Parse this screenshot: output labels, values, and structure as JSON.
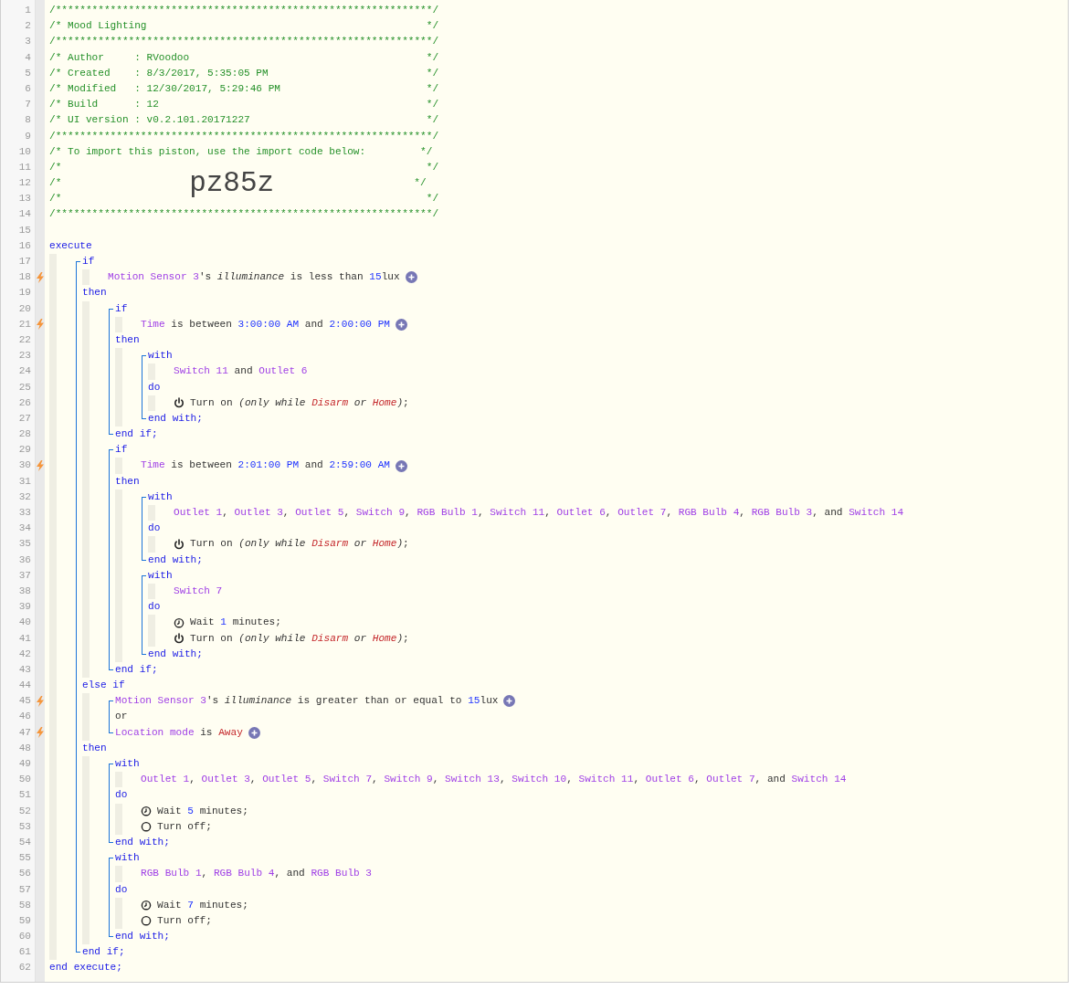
{
  "listing": [
    {
      "num": "1",
      "trigger": false,
      "segments": [
        {
          "kind": "comment",
          "text": "/**************************************************************/"
        }
      ]
    },
    {
      "num": "2",
      "trigger": false,
      "segments": [
        {
          "kind": "comment",
          "text": "/* Mood Lighting                                              */"
        }
      ]
    },
    {
      "num": "3",
      "trigger": false,
      "segments": [
        {
          "kind": "comment",
          "text": "/**************************************************************/"
        }
      ]
    },
    {
      "num": "4",
      "trigger": false,
      "segments": [
        {
          "kind": "comment",
          "text": "/* Author     : RVoodoo                                       */"
        }
      ]
    },
    {
      "num": "5",
      "trigger": false,
      "segments": [
        {
          "kind": "comment",
          "text": "/* Created    : 8/3/2017, 5:35:05 PM                          */"
        }
      ]
    },
    {
      "num": "6",
      "trigger": false,
      "segments": [
        {
          "kind": "comment",
          "text": "/* Modified   : 12/30/2017, 5:29:46 PM                        */"
        }
      ]
    },
    {
      "num": "7",
      "trigger": false,
      "segments": [
        {
          "kind": "comment",
          "text": "/* Build      : 12                                            */"
        }
      ]
    },
    {
      "num": "8",
      "trigger": false,
      "segments": [
        {
          "kind": "comment",
          "text": "/* UI version : v0.2.101.20171227                             */"
        }
      ]
    },
    {
      "num": "9",
      "trigger": false,
      "segments": [
        {
          "kind": "comment",
          "text": "/**************************************************************/"
        }
      ]
    },
    {
      "num": "10",
      "trigger": false,
      "segments": [
        {
          "kind": "comment",
          "text": "/* To import this piston, use the import code below:         */"
        }
      ]
    },
    {
      "num": "11",
      "trigger": false,
      "segments": [
        {
          "kind": "comment",
          "text": "/*                                                            */"
        }
      ]
    },
    {
      "num": "12",
      "trigger": false,
      "segments": [
        {
          "kind": "comment",
          "text": "/*                     "
        },
        {
          "kind": "code",
          "text": "pz85z"
        },
        {
          "kind": "comment",
          "text": "                       */"
        }
      ]
    },
    {
      "num": "13",
      "trigger": false,
      "segments": [
        {
          "kind": "comment",
          "text": "/*                                                            */"
        }
      ]
    },
    {
      "num": "14",
      "trigger": false,
      "segments": [
        {
          "kind": "comment",
          "text": "/**************************************************************/"
        }
      ]
    },
    {
      "num": "15",
      "trigger": false
    },
    {
      "header": {
        "num": "16",
        "trigger": false,
        "segments": [
          {
            "kind": "kw",
            "text": "execute"
          }
        ]
      },
      "body": [
        {
          "items": [
            {
              "header": {
                "num": "17",
                "trigger": false,
                "segments": [
                  {
                    "kind": "kw",
                    "text": "if"
                  }
                ]
              },
              "body": [
                {
                  "num": "18",
                  "trigger": true,
                  "segments": [
                    {
                      "kind": "dev",
                      "text": "Motion Sensor 3"
                    },
                    {
                      "kind": "txt",
                      "text": "'s "
                    },
                    {
                      "kind": "em",
                      "text": "illuminance"
                    },
                    {
                      "kind": "txt",
                      "text": " is less than "
                    },
                    {
                      "kind": "num",
                      "text": "15"
                    },
                    {
                      "kind": "txt",
                      "text": "lux"
                    },
                    {
                      "kind": "add"
                    }
                  ]
                }
              ]
            },
            {
              "header": {
                "num": "19",
                "trigger": false,
                "segments": [
                  {
                    "kind": "kw",
                    "text": "then"
                  }
                ]
              },
              "body": [
                {
                  "items": [
                    {
                      "header": {
                        "num": "20",
                        "trigger": false,
                        "segments": [
                          {
                            "kind": "kw",
                            "text": "if"
                          }
                        ]
                      },
                      "body": [
                        {
                          "num": "21",
                          "trigger": true,
                          "segments": [
                            {
                              "kind": "dev",
                              "text": "Time"
                            },
                            {
                              "kind": "txt",
                              "text": " is between "
                            },
                            {
                              "kind": "num",
                              "text": "3:00:00 AM"
                            },
                            {
                              "kind": "txt",
                              "text": " and "
                            },
                            {
                              "kind": "num",
                              "text": "2:00:00 PM"
                            },
                            {
                              "kind": "add"
                            }
                          ]
                        }
                      ]
                    },
                    {
                      "header": {
                        "num": "22",
                        "trigger": false,
                        "segments": [
                          {
                            "kind": "kw",
                            "text": "then"
                          }
                        ]
                      },
                      "body": [
                        {
                          "items": [
                            {
                              "header": {
                                "num": "23",
                                "trigger": false,
                                "segments": [
                                  {
                                    "kind": "kw",
                                    "text": "with"
                                  }
                                ]
                              },
                              "body": [
                                {
                                  "num": "24",
                                  "trigger": false,
                                  "segments": [
                                    {
                                      "kind": "dev",
                                      "text": "Switch 11"
                                    },
                                    {
                                      "kind": "txt",
                                      "text": " and "
                                    },
                                    {
                                      "kind": "dev",
                                      "text": "Outlet 6"
                                    }
                                  ]
                                }
                              ]
                            },
                            {
                              "header": {
                                "num": "25",
                                "trigger": false,
                                "segments": [
                                  {
                                    "kind": "kw",
                                    "text": "do"
                                  }
                                ]
                              },
                              "body": [
                                {
                                  "num": "26",
                                  "trigger": false,
                                  "kind": "on",
                                  "segments": [
                                    {
                                      "kind": "txt",
                                      "text": "Turn on "
                                    },
                                    {
                                      "kind": "em",
                                      "text": "(only while "
                                    },
                                    {
                                      "kind": "red-em",
                                      "text": "Disarm"
                                    },
                                    {
                                      "kind": "em",
                                      "text": " or "
                                    },
                                    {
                                      "kind": "red-em",
                                      "text": "Home"
                                    },
                                    {
                                      "kind": "em",
                                      "text": ")"
                                    },
                                    {
                                      "kind": "txt",
                                      "text": ";"
                                    }
                                  ]
                                }
                              ]
                            },
                            {
                              "num": "27",
                              "trigger": false,
                              "segments": [
                                {
                                  "kind": "kw",
                                  "text": "end with;"
                                }
                              ]
                            }
                          ]
                        }
                      ]
                    },
                    {
                      "num": "28",
                      "trigger": false,
                      "segments": [
                        {
                          "kind": "kw",
                          "text": "end if;"
                        }
                      ]
                    }
                  ]
                },
                {
                  "items": [
                    {
                      "header": {
                        "num": "29",
                        "trigger": false,
                        "segments": [
                          {
                            "kind": "kw",
                            "text": "if"
                          }
                        ]
                      },
                      "body": [
                        {
                          "num": "30",
                          "trigger": true,
                          "segments": [
                            {
                              "kind": "dev",
                              "text": "Time"
                            },
                            {
                              "kind": "txt",
                              "text": " is between "
                            },
                            {
                              "kind": "num",
                              "text": "2:01:00 PM"
                            },
                            {
                              "kind": "txt",
                              "text": " and "
                            },
                            {
                              "kind": "num",
                              "text": "2:59:00 AM"
                            },
                            {
                              "kind": "add"
                            }
                          ]
                        }
                      ]
                    },
                    {
                      "header": {
                        "num": "31",
                        "trigger": false,
                        "segments": [
                          {
                            "kind": "kw",
                            "text": "then"
                          }
                        ]
                      },
                      "body": [
                        {
                          "items": [
                            {
                              "header": {
                                "num": "32",
                                "trigger": false,
                                "segments": [
                                  {
                                    "kind": "kw",
                                    "text": "with"
                                  }
                                ]
                              },
                              "body": [
                                {
                                  "num": "33",
                                  "trigger": false,
                                  "segments": [
                                    {
                                      "kind": "dev",
                                      "text": "Outlet 1"
                                    },
                                    {
                                      "kind": "txt",
                                      "text": ", "
                                    },
                                    {
                                      "kind": "dev",
                                      "text": "Outlet 3"
                                    },
                                    {
                                      "kind": "txt",
                                      "text": ", "
                                    },
                                    {
                                      "kind": "dev",
                                      "text": "Outlet 5"
                                    },
                                    {
                                      "kind": "txt",
                                      "text": ", "
                                    },
                                    {
                                      "kind": "dev",
                                      "text": "Switch 9"
                                    },
                                    {
                                      "kind": "txt",
                                      "text": ", "
                                    },
                                    {
                                      "kind": "dev",
                                      "text": "RGB Bulb 1"
                                    },
                                    {
                                      "kind": "txt",
                                      "text": ", "
                                    },
                                    {
                                      "kind": "dev",
                                      "text": "Switch 11"
                                    },
                                    {
                                      "kind": "txt",
                                      "text": ", "
                                    },
                                    {
                                      "kind": "dev",
                                      "text": "Outlet 6"
                                    },
                                    {
                                      "kind": "txt",
                                      "text": ", "
                                    },
                                    {
                                      "kind": "dev",
                                      "text": "Outlet 7"
                                    },
                                    {
                                      "kind": "txt",
                                      "text": ", "
                                    },
                                    {
                                      "kind": "dev",
                                      "text": "RGB Bulb 4"
                                    },
                                    {
                                      "kind": "txt",
                                      "text": ", "
                                    },
                                    {
                                      "kind": "dev",
                                      "text": "RGB Bulb 3"
                                    },
                                    {
                                      "kind": "txt",
                                      "text": ", and "
                                    },
                                    {
                                      "kind": "dev",
                                      "text": "Switch 14"
                                    }
                                  ]
                                }
                              ]
                            },
                            {
                              "header": {
                                "num": "34",
                                "trigger": false,
                                "segments": [
                                  {
                                    "kind": "kw",
                                    "text": "do"
                                  }
                                ]
                              },
                              "body": [
                                {
                                  "num": "35",
                                  "trigger": false,
                                  "kind": "on",
                                  "segments": [
                                    {
                                      "kind": "txt",
                                      "text": "Turn on "
                                    },
                                    {
                                      "kind": "em",
                                      "text": "(only while "
                                    },
                                    {
                                      "kind": "red-em",
                                      "text": "Disarm"
                                    },
                                    {
                                      "kind": "em",
                                      "text": " or "
                                    },
                                    {
                                      "kind": "red-em",
                                      "text": "Home"
                                    },
                                    {
                                      "kind": "em",
                                      "text": ")"
                                    },
                                    {
                                      "kind": "txt",
                                      "text": ";"
                                    }
                                  ]
                                }
                              ]
                            },
                            {
                              "num": "36",
                              "trigger": false,
                              "segments": [
                                {
                                  "kind": "kw",
                                  "text": "end with;"
                                }
                              ]
                            }
                          ]
                        },
                        {
                          "items": [
                            {
                              "header": {
                                "num": "37",
                                "trigger": false,
                                "segments": [
                                  {
                                    "kind": "kw",
                                    "text": "with"
                                  }
                                ]
                              },
                              "body": [
                                {
                                  "num": "38",
                                  "trigger": false,
                                  "segments": [
                                    {
                                      "kind": "dev",
                                      "text": "Switch 7"
                                    }
                                  ]
                                }
                              ]
                            },
                            {
                              "header": {
                                "num": "39",
                                "trigger": false,
                                "segments": [
                                  {
                                    "kind": "kw",
                                    "text": "do"
                                  }
                                ]
                              },
                              "body": [
                                {
                                  "num": "40",
                                  "trigger": false,
                                  "kind": "wait",
                                  "segments": [
                                    {
                                      "kind": "txt",
                                      "text": "Wait "
                                    },
                                    {
                                      "kind": "num",
                                      "text": "1"
                                    },
                                    {
                                      "kind": "txt",
                                      "text": " minutes;"
                                    }
                                  ]
                                },
                                {
                                  "num": "41",
                                  "trigger": false,
                                  "kind": "on",
                                  "segments": [
                                    {
                                      "kind": "txt",
                                      "text": "Turn on "
                                    },
                                    {
                                      "kind": "em",
                                      "text": "(only while "
                                    },
                                    {
                                      "kind": "red-em",
                                      "text": "Disarm"
                                    },
                                    {
                                      "kind": "em",
                                      "text": " or "
                                    },
                                    {
                                      "kind": "red-em",
                                      "text": "Home"
                                    },
                                    {
                                      "kind": "em",
                                      "text": ")"
                                    },
                                    {
                                      "kind": "txt",
                                      "text": ";"
                                    }
                                  ]
                                }
                              ]
                            },
                            {
                              "num": "42",
                              "trigger": false,
                              "segments": [
                                {
                                  "kind": "kw",
                                  "text": "end with;"
                                }
                              ]
                            }
                          ]
                        }
                      ]
                    },
                    {
                      "num": "43",
                      "trigger": false,
                      "segments": [
                        {
                          "kind": "kw",
                          "text": "end if;"
                        }
                      ]
                    }
                  ]
                }
              ]
            },
            {
              "header": {
                "num": "44",
                "trigger": false,
                "segments": [
                  {
                    "kind": "kw",
                    "text": "else if"
                  }
                ]
              },
              "body": [
                {
                  "items": [
                    {
                      "num": "45",
                      "trigger": true,
                      "segments": [
                        {
                          "kind": "dev",
                          "text": "Motion Sensor 3"
                        },
                        {
                          "kind": "txt",
                          "text": "'s "
                        },
                        {
                          "kind": "em",
                          "text": "illuminance"
                        },
                        {
                          "kind": "txt",
                          "text": " is greater than or equal to "
                        },
                        {
                          "kind": "num",
                          "text": "15"
                        },
                        {
                          "kind": "txt",
                          "text": "lux"
                        },
                        {
                          "kind": "add"
                        }
                      ]
                    },
                    {
                      "num": "46",
                      "trigger": false,
                      "segments": [
                        {
                          "kind": "txt",
                          "text": "or"
                        }
                      ]
                    },
                    {
                      "num": "47",
                      "trigger": true,
                      "segments": [
                        {
                          "kind": "dev",
                          "text": "Location mode"
                        },
                        {
                          "kind": "txt",
                          "text": " is "
                        },
                        {
                          "kind": "red",
                          "text": "Away"
                        },
                        {
                          "kind": "add"
                        }
                      ]
                    }
                  ]
                }
              ]
            },
            {
              "header": {
                "num": "48",
                "trigger": false,
                "segments": [
                  {
                    "kind": "kw",
                    "text": "then"
                  }
                ]
              },
              "body": [
                {
                  "items": [
                    {
                      "header": {
                        "num": "49",
                        "trigger": false,
                        "segments": [
                          {
                            "kind": "kw",
                            "text": "with"
                          }
                        ]
                      },
                      "body": [
                        {
                          "num": "50",
                          "trigger": false,
                          "segments": [
                            {
                              "kind": "dev",
                              "text": "Outlet 1"
                            },
                            {
                              "kind": "txt",
                              "text": ", "
                            },
                            {
                              "kind": "dev",
                              "text": "Outlet 3"
                            },
                            {
                              "kind": "txt",
                              "text": ", "
                            },
                            {
                              "kind": "dev",
                              "text": "Outlet 5"
                            },
                            {
                              "kind": "txt",
                              "text": ", "
                            },
                            {
                              "kind": "dev",
                              "text": "Switch 7"
                            },
                            {
                              "kind": "txt",
                              "text": ", "
                            },
                            {
                              "kind": "dev",
                              "text": "Switch 9"
                            },
                            {
                              "kind": "txt",
                              "text": ", "
                            },
                            {
                              "kind": "dev",
                              "text": "Switch 13"
                            },
                            {
                              "kind": "txt",
                              "text": ", "
                            },
                            {
                              "kind": "dev",
                              "text": "Switch 10"
                            },
                            {
                              "kind": "txt",
                              "text": ", "
                            },
                            {
                              "kind": "dev",
                              "text": "Switch 11"
                            },
                            {
                              "kind": "txt",
                              "text": ", "
                            },
                            {
                              "kind": "dev",
                              "text": "Outlet 6"
                            },
                            {
                              "kind": "txt",
                              "text": ", "
                            },
                            {
                              "kind": "dev",
                              "text": "Outlet 7"
                            },
                            {
                              "kind": "txt",
                              "text": ", and "
                            },
                            {
                              "kind": "dev",
                              "text": "Switch 14"
                            }
                          ]
                        }
                      ]
                    },
                    {
                      "header": {
                        "num": "51",
                        "trigger": false,
                        "segments": [
                          {
                            "kind": "kw",
                            "text": "do"
                          }
                        ]
                      },
                      "body": [
                        {
                          "num": "52",
                          "trigger": false,
                          "kind": "wait",
                          "segments": [
                            {
                              "kind": "txt",
                              "text": "Wait "
                            },
                            {
                              "kind": "num",
                              "text": "5"
                            },
                            {
                              "kind": "txt",
                              "text": " minutes;"
                            }
                          ]
                        },
                        {
                          "num": "53",
                          "trigger": false,
                          "kind": "off",
                          "segments": [
                            {
                              "kind": "txt",
                              "text": "Turn off;"
                            }
                          ]
                        }
                      ]
                    },
                    {
                      "num": "54",
                      "trigger": false,
                      "segments": [
                        {
                          "kind": "kw",
                          "text": "end with;"
                        }
                      ]
                    }
                  ]
                },
                {
                  "items": [
                    {
                      "header": {
                        "num": "55",
                        "trigger": false,
                        "segments": [
                          {
                            "kind": "kw",
                            "text": "with"
                          }
                        ]
                      },
                      "body": [
                        {
                          "num": "56",
                          "trigger": false,
                          "segments": [
                            {
                              "kind": "dev",
                              "text": "RGB Bulb 1"
                            },
                            {
                              "kind": "txt",
                              "text": ", "
                            },
                            {
                              "kind": "dev",
                              "text": "RGB Bulb 4"
                            },
                            {
                              "kind": "txt",
                              "text": ", and "
                            },
                            {
                              "kind": "dev",
                              "text": "RGB Bulb 3"
                            }
                          ]
                        }
                      ]
                    },
                    {
                      "header": {
                        "num": "57",
                        "trigger": false,
                        "segments": [
                          {
                            "kind": "kw",
                            "text": "do"
                          }
                        ]
                      },
                      "body": [
                        {
                          "num": "58",
                          "trigger": false,
                          "kind": "wait",
                          "segments": [
                            {
                              "kind": "txt",
                              "text": "Wait "
                            },
                            {
                              "kind": "num",
                              "text": "7"
                            },
                            {
                              "kind": "txt",
                              "text": " minutes;"
                            }
                          ]
                        },
                        {
                          "num": "59",
                          "trigger": false,
                          "kind": "off",
                          "segments": [
                            {
                              "kind": "txt",
                              "text": "Turn off;"
                            }
                          ]
                        }
                      ]
                    },
                    {
                      "num": "60",
                      "trigger": false,
                      "segments": [
                        {
                          "kind": "kw",
                          "text": "end with;"
                        }
                      ]
                    }
                  ]
                }
              ]
            },
            {
              "num": "61",
              "trigger": false,
              "segments": [
                {
                  "kind": "kw",
                  "text": "end if;"
                }
              ]
            }
          ]
        }
      ]
    },
    {
      "num": "62",
      "trigger": false,
      "segments": [
        {
          "kind": "kw",
          "text": "end execute;"
        }
      ]
    }
  ]
}
